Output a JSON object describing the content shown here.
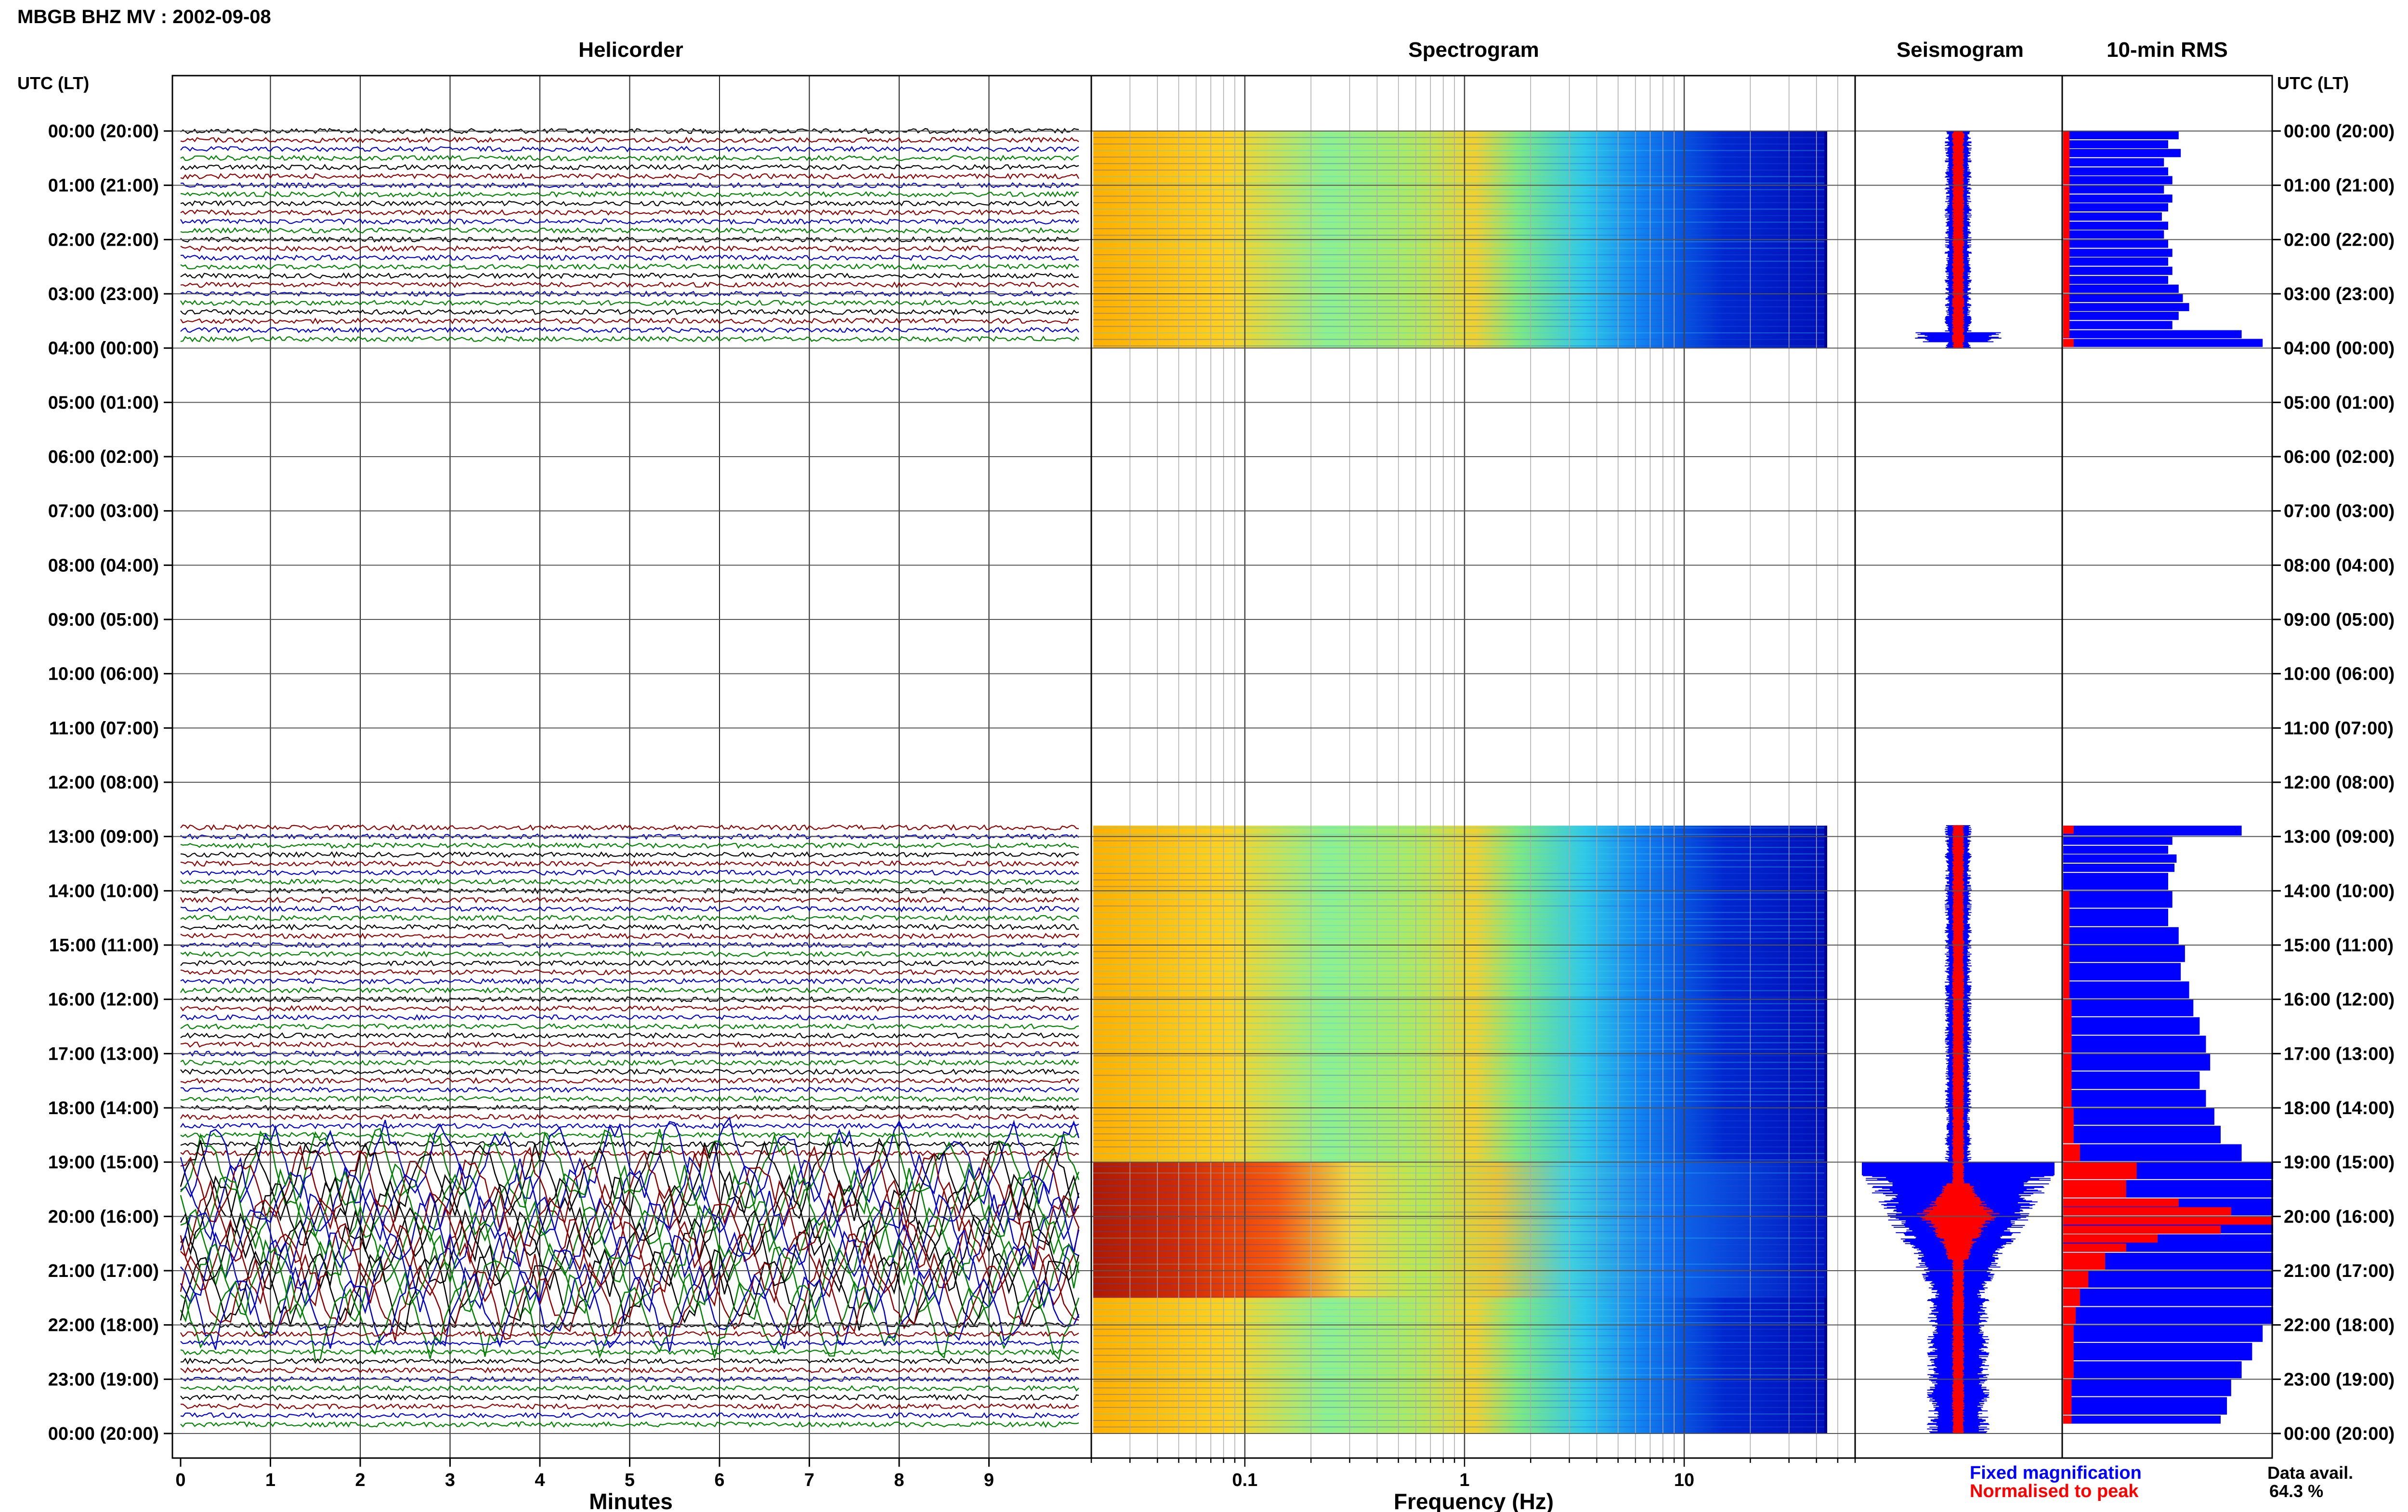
{
  "header": {
    "station_title": "MBGB BHZ MV : 2002-09-08",
    "utc_lt_label": "UTC (LT)"
  },
  "panels": {
    "helicorder": "Helicorder",
    "spectrogram": "Spectrogram",
    "seismogram": "Seismogram",
    "rms": "10-min RMS"
  },
  "footer": {
    "legend_fixed": "Fixed magnification",
    "legend_normalised": "Normalised to peak",
    "data_avail_label": "Data avail.",
    "data_avail_value": "64.3 %"
  },
  "colors": {
    "fixed": "#0000ff",
    "normalised": "#ff0000",
    "trace_cycle": [
      "#000000",
      "#8b0000",
      "#0000cd",
      "#008000"
    ]
  },
  "chart_data": [
    {
      "type": "line",
      "name": "helicorder",
      "title": "Helicorder",
      "xlabel": "Minutes",
      "ylabel": "UTC (LT)",
      "x_ticks": [
        "0",
        "1",
        "2",
        "3",
        "4",
        "5",
        "6",
        "7",
        "8",
        "9"
      ],
      "xlim": [
        0,
        10
      ],
      "time_labels": [
        "00:00 (20:00)",
        "01:00 (21:00)",
        "02:00 (22:00)",
        "03:00 (23:00)",
        "04:00 (00:00)",
        "05:00 (01:00)",
        "06:00 (02:00)",
        "07:00 (03:00)",
        "08:00 (04:00)",
        "09:00 (05:00)",
        "10:00 (06:00)",
        "11:00 (07:00)",
        "12:00 (08:00)",
        "13:00 (09:00)",
        "14:00 (10:00)",
        "15:00 (11:00)",
        "16:00 (12:00)",
        "17:00 (13:00)",
        "18:00 (14:00)",
        "19:00 (15:00)",
        "20:00 (16:00)",
        "21:00 (17:00)",
        "22:00 (18:00)",
        "23:00 (19:00)",
        "00:00 (20:00)"
      ],
      "data_segments_utc_hours": [
        [
          0,
          4
        ],
        [
          12.8,
          24
        ]
      ],
      "high_amplitude_utc_hours": [
        19,
        22
      ],
      "grid": true
    },
    {
      "type": "heatmap",
      "name": "spectrogram",
      "title": "Spectrogram",
      "xlabel": "Frequency (Hz)",
      "x_scale": "log",
      "x_ticks": [
        "0.1",
        "1",
        "10"
      ],
      "xlim": [
        0.02,
        60
      ],
      "data_segments_utc_hours": [
        [
          0,
          4
        ],
        [
          12.8,
          24
        ]
      ],
      "strong_low_frequency_utc_hours": [
        19,
        21.5
      ]
    },
    {
      "type": "line",
      "name": "seismogram",
      "title": "Seismogram",
      "data_segments_utc_hours": [
        [
          0,
          4
        ],
        [
          12.8,
          24
        ]
      ],
      "series": [
        {
          "name": "Fixed magnification",
          "color": "#0000ff"
        },
        {
          "name": "Normalised to peak",
          "color": "#ff0000"
        }
      ]
    },
    {
      "type": "bar",
      "name": "rms",
      "title": "10-min RMS",
      "orientation": "horizontal",
      "series": [
        {
          "name": "Fixed magnification",
          "color": "#0000ff",
          "points": [
            [
              0.0,
              0.55
            ],
            [
              0.17,
              0.5
            ],
            [
              0.33,
              0.56
            ],
            [
              0.5,
              0.48
            ],
            [
              0.67,
              0.5
            ],
            [
              0.83,
              0.52
            ],
            [
              1.0,
              0.48
            ],
            [
              1.17,
              0.52
            ],
            [
              1.33,
              0.5
            ],
            [
              1.5,
              0.47
            ],
            [
              1.67,
              0.5
            ],
            [
              1.83,
              0.48
            ],
            [
              2.0,
              0.5
            ],
            [
              2.17,
              0.52
            ],
            [
              2.33,
              0.5
            ],
            [
              2.5,
              0.52
            ],
            [
              2.67,
              0.5
            ],
            [
              2.83,
              0.55
            ],
            [
              3.0,
              0.57
            ],
            [
              3.17,
              0.6
            ],
            [
              3.33,
              0.55
            ],
            [
              3.5,
              0.52
            ],
            [
              3.67,
              0.85
            ],
            [
              3.83,
              0.95
            ]
          ]
        },
        {
          "name": "Fixed magnification",
          "color": "#0000ff",
          "points": [
            [
              12.8,
              0.85
            ],
            [
              13.0,
              0.52
            ],
            [
              13.17,
              0.5
            ],
            [
              13.33,
              0.54
            ],
            [
              13.5,
              0.53
            ],
            [
              13.67,
              0.5
            ],
            [
              14.0,
              0.52
            ],
            [
              14.33,
              0.5
            ],
            [
              14.67,
              0.55
            ],
            [
              15.0,
              0.58
            ],
            [
              15.33,
              0.56
            ],
            [
              15.67,
              0.6
            ],
            [
              16.0,
              0.62
            ],
            [
              16.33,
              0.65
            ],
            [
              16.67,
              0.68
            ],
            [
              17.0,
              0.7
            ],
            [
              17.33,
              0.65
            ],
            [
              17.67,
              0.68
            ],
            [
              18.0,
              0.72
            ],
            [
              18.33,
              0.75
            ],
            [
              18.67,
              0.85
            ],
            [
              19.0,
              1.0
            ],
            [
              19.33,
              1.0
            ],
            [
              19.67,
              1.0
            ],
            [
              20.0,
              1.0
            ],
            [
              20.33,
              1.0
            ],
            [
              20.67,
              1.0
            ],
            [
              21.0,
              1.0
            ],
            [
              21.33,
              1.0
            ],
            [
              21.67,
              1.0
            ],
            [
              22.0,
              0.95
            ],
            [
              22.33,
              0.9
            ],
            [
              22.67,
              0.85
            ],
            [
              23.0,
              0.8
            ],
            [
              23.33,
              0.78
            ],
            [
              23.67,
              0.75
            ]
          ]
        },
        {
          "name": "Normalised to peak",
          "color": "#ff0000",
          "points": [
            [
              0.0,
              0.03
            ],
            [
              1.0,
              0.03
            ],
            [
              2.0,
              0.03
            ],
            [
              3.0,
              0.03
            ],
            [
              3.83,
              0.05
            ],
            [
              12.8,
              0.05
            ],
            [
              14.0,
              0.03
            ],
            [
              15.0,
              0.03
            ],
            [
              16.0,
              0.04
            ],
            [
              17.0,
              0.04
            ],
            [
              18.0,
              0.05
            ],
            [
              18.67,
              0.08
            ],
            [
              19.0,
              0.35
            ],
            [
              19.33,
              0.3
            ],
            [
              19.67,
              0.55
            ],
            [
              19.83,
              0.8
            ],
            [
              20.0,
              1.0
            ],
            [
              20.17,
              0.75
            ],
            [
              20.33,
              0.45
            ],
            [
              20.5,
              0.3
            ],
            [
              20.67,
              0.2
            ],
            [
              21.0,
              0.12
            ],
            [
              21.33,
              0.08
            ],
            [
              21.67,
              0.06
            ],
            [
              22.0,
              0.05
            ],
            [
              23.0,
              0.04
            ],
            [
              23.67,
              0.04
            ]
          ]
        }
      ]
    }
  ]
}
